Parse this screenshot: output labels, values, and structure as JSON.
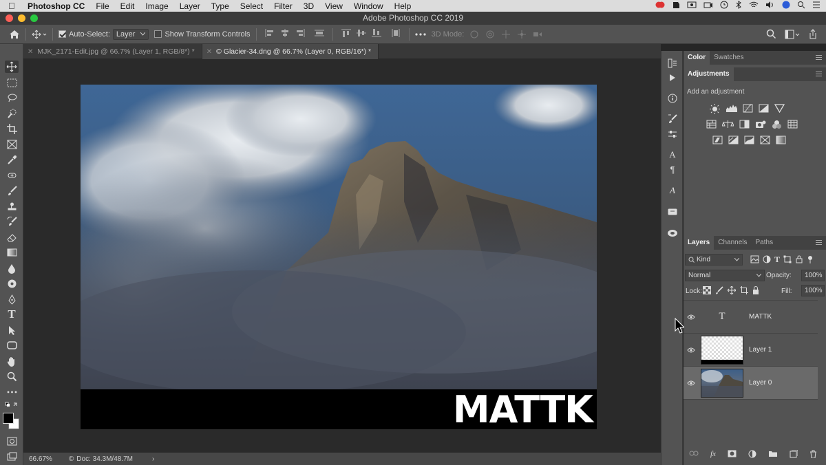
{
  "menubar": {
    "app": "Photoshop CC",
    "items": [
      "File",
      "Edit",
      "Image",
      "Layer",
      "Type",
      "Select",
      "Filter",
      "3D",
      "View",
      "Window",
      "Help"
    ]
  },
  "window": {
    "title": "Adobe Photoshop CC 2019"
  },
  "options": {
    "auto_select_label": "Auto-Select:",
    "auto_select_checked": true,
    "auto_select_target": "Layer",
    "transform_label": "Show Transform Controls",
    "transform_checked": false,
    "mode_3d_label": "3D Mode:"
  },
  "tabs": [
    {
      "label": "MJK_2171-Edit.jpg @ 66.7% (Layer 1, RGB/8*) *",
      "active": false
    },
    {
      "label": "© Glacier-34.dng @ 66.7% (Layer 0, RGB/16*) *",
      "active": true
    }
  ],
  "document": {
    "overlay_text": "MATTK"
  },
  "status": {
    "zoom": "66.67%",
    "doc_size": "Doc: 34.3M/48.7M"
  },
  "color_panel": {
    "tabs": [
      "Color",
      "Swatches"
    ],
    "active": "Color"
  },
  "adjustments": {
    "title": "Adjustments",
    "hint": "Add an adjustment"
  },
  "layers_panel": {
    "tabs": [
      "Layers",
      "Channels",
      "Paths"
    ],
    "active": "Layers",
    "filter_kind": "Kind",
    "blend_mode": "Normal",
    "opacity_label": "Opacity:",
    "opacity": "100%",
    "lock_label": "Lock:",
    "fill_label": "Fill:",
    "fill": "100%",
    "layers": [
      {
        "name": "MATTK",
        "type": "text",
        "selected": false
      },
      {
        "name": "Layer 1",
        "type": "pixel",
        "selected": false
      },
      {
        "name": "Layer 0",
        "type": "image",
        "selected": true
      }
    ]
  },
  "colors": {
    "accent_close": "#fc5f57",
    "accent_min": "#fdbc2e",
    "accent_max": "#28c840",
    "selected_layer": "#6a6a6a"
  }
}
